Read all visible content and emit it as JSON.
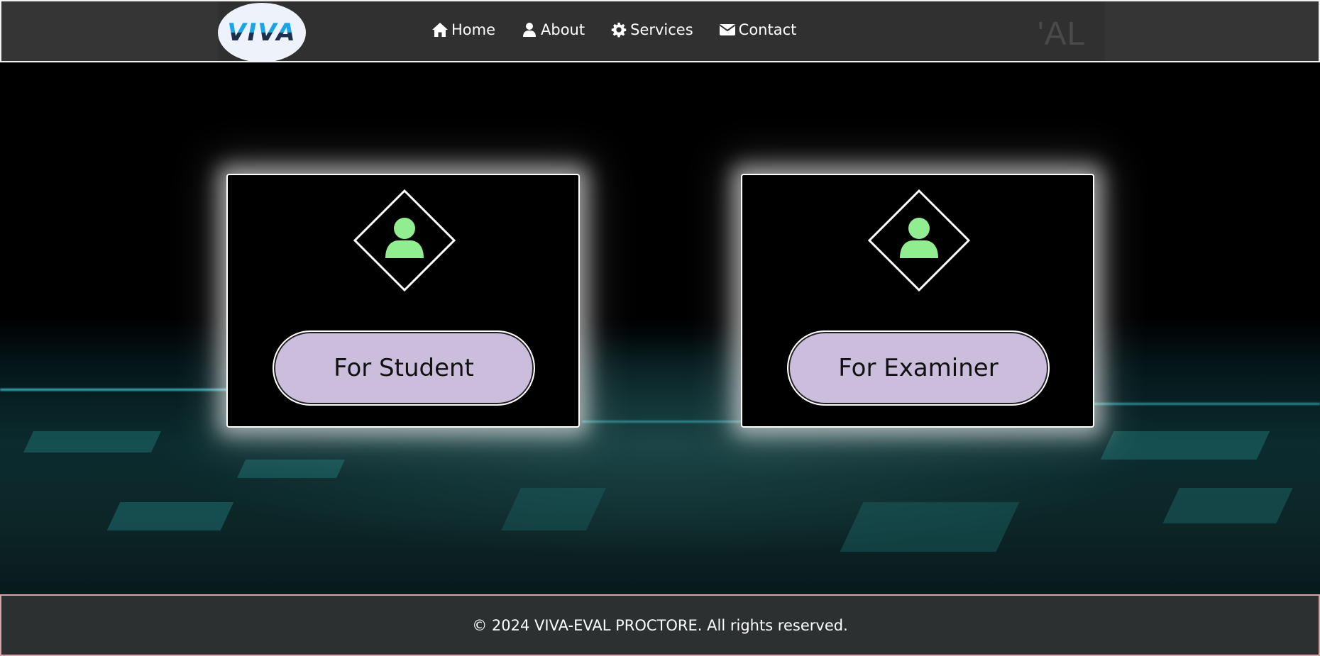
{
  "header": {
    "logo_text": "VIVA",
    "ghost_text": "'AL",
    "nav": [
      {
        "label": "Home",
        "icon": "home-icon"
      },
      {
        "label": "About",
        "icon": "user-icon"
      },
      {
        "label": "Services",
        "icon": "gear-icon"
      },
      {
        "label": "Contact",
        "icon": "envelope-icon"
      }
    ]
  },
  "cards": {
    "student": {
      "button_label": "For Student",
      "icon": "user-icon"
    },
    "examiner": {
      "button_label": "For Examiner",
      "icon": "user-icon"
    }
  },
  "footer": {
    "copyright": "© 2024 VIVA-EVAL PROCTORE. All rights reserved."
  },
  "colors": {
    "header_bg": "#353535",
    "button_bg": "#cbbedd",
    "icon_green": "#90ee90",
    "footer_bg": "#2c3030"
  }
}
